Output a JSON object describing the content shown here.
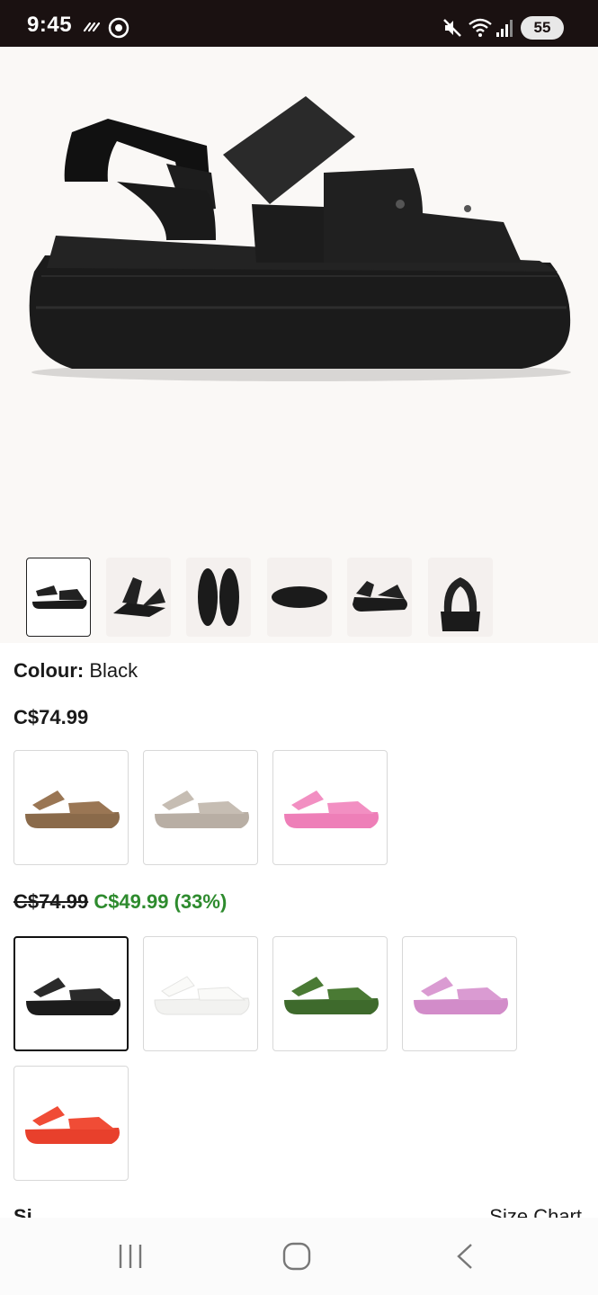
{
  "status_bar": {
    "time": "9:45",
    "battery": "55",
    "icons": [
      "activity-icon",
      "media-icon",
      "mute-icon",
      "wifi-icon",
      "signal-icon",
      "battery-icon"
    ]
  },
  "product": {
    "colour_label": "Colour:",
    "colour_value": "Black",
    "price": "C$74.99",
    "sale_old_price": "C$74.99",
    "sale_new_price": "C$49.99 (33%)",
    "size_label": "Si",
    "size_chart_label": "Size Chart"
  },
  "thumbnails": [
    "side view",
    "angle view",
    "top view pair",
    "sole view",
    "three-quarter view",
    "back view"
  ],
  "colors": {
    "shoe_black": "#1e1e1e",
    "full_price_swatches": [
      "#8a6a4a",
      "#b8aea4",
      "#ee7fb8"
    ],
    "sale_swatches": [
      "#1c1c1c",
      "#f2f2f0",
      "#3e6a2c",
      "#d28cc9",
      "#e8402c"
    ],
    "sale_green": "#2e8b2e"
  }
}
